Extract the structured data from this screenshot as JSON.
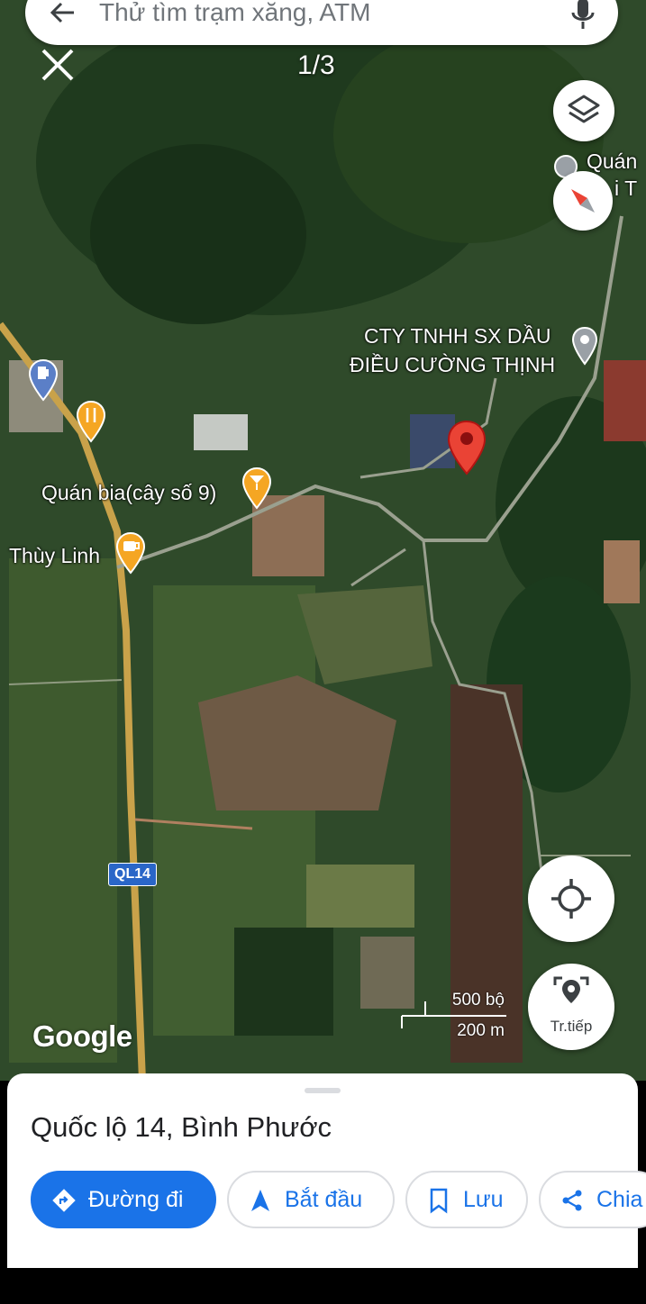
{
  "search": {
    "placeholder": "Thử tìm trạm xăng, ATM"
  },
  "viewer": {
    "counter": "1/3"
  },
  "map_labels": {
    "company_line1": "CTY TNHH SX DẦU",
    "company_line2": "ĐIỀU CƯỜNG THỊNH",
    "quan_bia": "Quán bia(cây số 9)",
    "thuy_linh": "Thùy Linh",
    "quan_partial": "Quán",
    "quan_partial2": "i T",
    "road_shield": "QL14"
  },
  "attribution": "Google",
  "scale": {
    "feet": "500 bộ",
    "meters": "200 m"
  },
  "buttons": {
    "navigate_label": "Tr.tiếp"
  },
  "sheet": {
    "place_name": "Quốc lộ 14, Bình Phước",
    "actions": [
      {
        "label": "Đường đi",
        "icon": "directions-icon"
      },
      {
        "label": "Bắt đầu",
        "icon": "navigation-arrow-icon"
      },
      {
        "label": "Lưu",
        "icon": "bookmark-icon"
      },
      {
        "label": "Chia",
        "icon": "share-icon"
      }
    ]
  },
  "colors": {
    "accent": "#1a73e8",
    "pin": "#ea4335",
    "poi_food": "#f5a623",
    "poi_fuel": "#5b7fc7"
  }
}
